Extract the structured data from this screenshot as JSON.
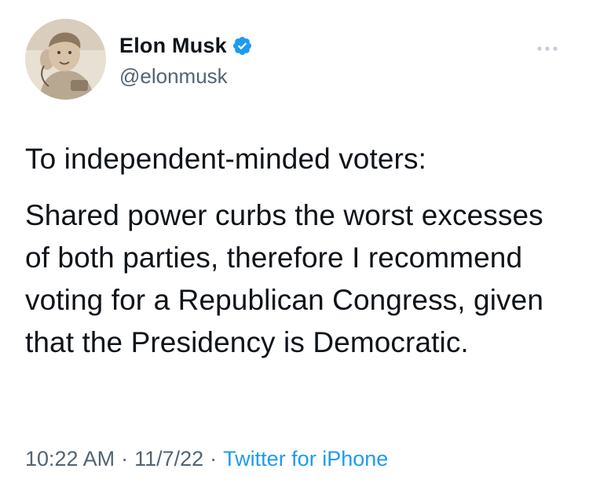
{
  "user": {
    "display_name": "Elon Musk",
    "handle": "@elonmusk",
    "verified": true,
    "verified_color": "#1d9bf0"
  },
  "tweet": {
    "paragraphs": [
      "To independent-minded voters:",
      "Shared power curbs the worst excesses of both parties, therefore I recommend voting for a Republican Congress, given that the Presidency is Democratic."
    ]
  },
  "meta": {
    "time": "10:22 AM",
    "separator": "·",
    "date": "11/7/22",
    "source": "Twitter for iPhone",
    "source_color": "#1d9bf0"
  },
  "icons": {
    "verified": "verified-badge-icon",
    "more": "more-options-icon"
  }
}
